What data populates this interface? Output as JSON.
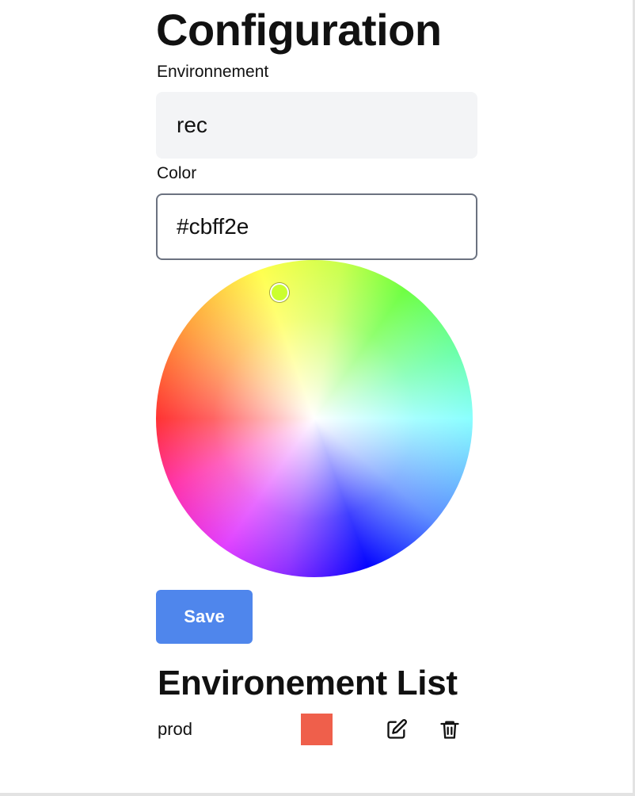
{
  "page": {
    "title": "Configuration"
  },
  "form": {
    "environment_label": "Environnement",
    "environment_value": "rec",
    "color_label": "Color",
    "color_value": "#cbff2e",
    "save_label": "Save"
  },
  "color_picker": {
    "selected_color": "#cbff2e"
  },
  "list": {
    "title": "Environement List",
    "items": [
      {
        "name": "prod",
        "color": "#ef5f4b",
        "edit_icon": "pencil-square-icon",
        "delete_icon": "trash-icon"
      }
    ]
  }
}
